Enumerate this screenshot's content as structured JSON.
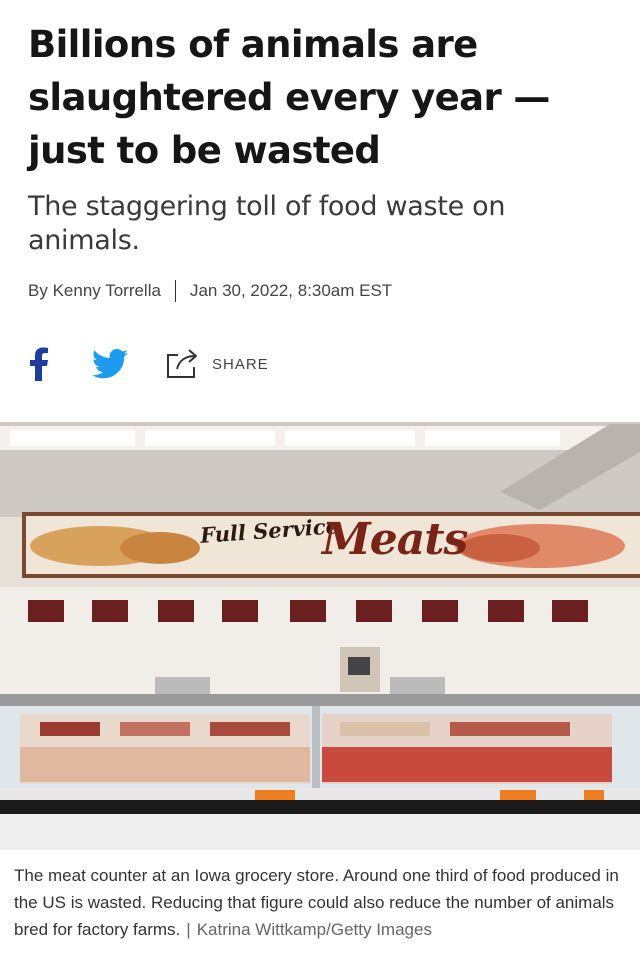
{
  "article": {
    "headline": "Billions of animals are slaughtered every year — just to be wasted",
    "dek": "The staggering toll of food waste on animals.",
    "byline": {
      "prefix": "By",
      "author": "Kenny Torrella",
      "date": "Jan 30, 2022, 8:30am EST"
    }
  },
  "share": {
    "facebook_icon": "facebook-icon",
    "twitter_icon": "twitter-icon",
    "share_icon": "share-icon",
    "share_label": "SHARE"
  },
  "photo": {
    "sign_small": "Full Service",
    "sign_big": "Meats"
  },
  "caption": {
    "text": "The meat counter at an Iowa grocery store. Around one third of food produced in the US is wasted. Reducing that figure could also reduce the number of animals bred for factory farms.",
    "separator": "|",
    "credit": "Katrina Wittkamp/Getty Images"
  },
  "colors": {
    "facebook": "#1c3f9e",
    "twitter": "#1d9bf0",
    "headline": "#161616"
  }
}
